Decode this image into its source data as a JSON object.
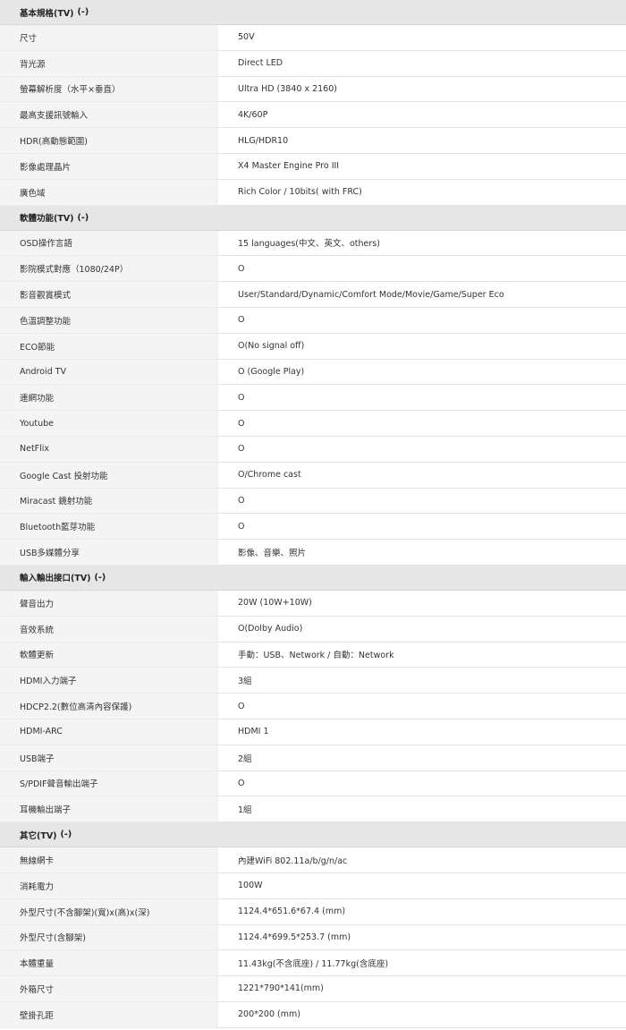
{
  "sections": [
    {
      "title": "基本規格(TV)",
      "toggle": "(-)",
      "rows": [
        {
          "label": "尺寸",
          "value": "50V"
        },
        {
          "label": "背光源",
          "value": "Direct LED"
        },
        {
          "label": "螢幕解析度（水平×垂直）",
          "value": "Ultra HD (3840 x 2160)"
        },
        {
          "label": "最高支援訊號輸入",
          "value": "4K/60P"
        },
        {
          "label": "HDR(高動態範圍)",
          "value": "HLG/HDR10"
        },
        {
          "label": "影像處理晶片",
          "value": "X4 Master Engine Pro III"
        },
        {
          "label": "廣色域",
          "value": "Rich Color / 10bits( with FRC)"
        }
      ]
    },
    {
      "title": "軟體功能(TV)",
      "toggle": "(-)",
      "rows": [
        {
          "label": "OSD操作言語",
          "value": "15 languages(中文、英文、others)"
        },
        {
          "label": "影院模式對應（1080/24P）",
          "value": "O"
        },
        {
          "label": "影音觀賞模式",
          "value": "User/Standard/Dynamic/Comfort Mode/Movie/Game/Super Eco"
        },
        {
          "label": "色溫調整功能",
          "value": "O"
        },
        {
          "label": "ECO節能",
          "value": "O(No signal off)"
        },
        {
          "label": "Android TV",
          "value": "O (Google Play)"
        },
        {
          "label": "連網功能",
          "value": "O"
        },
        {
          "label": "Youtube",
          "value": "O"
        },
        {
          "label": "NetFlix",
          "value": "O"
        },
        {
          "label": "Google Cast 投射功能",
          "value": "O/Chrome cast"
        },
        {
          "label": "Miracast 鏡射功能",
          "value": "O"
        },
        {
          "label": "Bluetooth藍芽功能",
          "value": "O"
        },
        {
          "label": "USB多媒體分享",
          "value": "影像、音樂、照片"
        }
      ]
    },
    {
      "title": "輸入輸出接口(TV)",
      "toggle": "(-)",
      "rows": [
        {
          "label": "聲音出力",
          "value": "20W (10W+10W)"
        },
        {
          "label": "音效系統",
          "value": "O(Dolby Audio)"
        },
        {
          "label": "軟體更新",
          "value": "手動：USB、Network / 自動：Network"
        },
        {
          "label": "HDMI入力端子",
          "value": "3組"
        },
        {
          "label": "HDCP2.2(數位高清內容保護)",
          "value": "O"
        },
        {
          "label": "HDMI-ARC",
          "value": "HDMI 1"
        },
        {
          "label": "USB端子",
          "value": "2組"
        },
        {
          "label": "S/PDIF聲音輸出端子",
          "value": "O"
        },
        {
          "label": "耳機輸出端子",
          "value": "1組"
        }
      ]
    },
    {
      "title": "其它(TV)",
      "toggle": "(-)",
      "rows": [
        {
          "label": "無線網卡",
          "value": "內建WiFi 802.11a/b/g/n/ac"
        },
        {
          "label": "消耗電力",
          "value": "100W"
        },
        {
          "label": "外型尺寸(不含腳架)(寬)x(高)x(深)",
          "value": "1124.4*651.6*67.4 (mm)"
        },
        {
          "label": "外型尺寸(含腳架)",
          "value": "1124.4*699.5*253.7 (mm)"
        },
        {
          "label": "本體重量",
          "value": "11.43kg(不含底座) / 11.77kg(含底座)"
        },
        {
          "label": "外箱尺寸",
          "value": "1221*790*141(mm)"
        },
        {
          "label": "壁掛孔距",
          "value": "200*200 (mm)"
        }
      ]
    }
  ]
}
